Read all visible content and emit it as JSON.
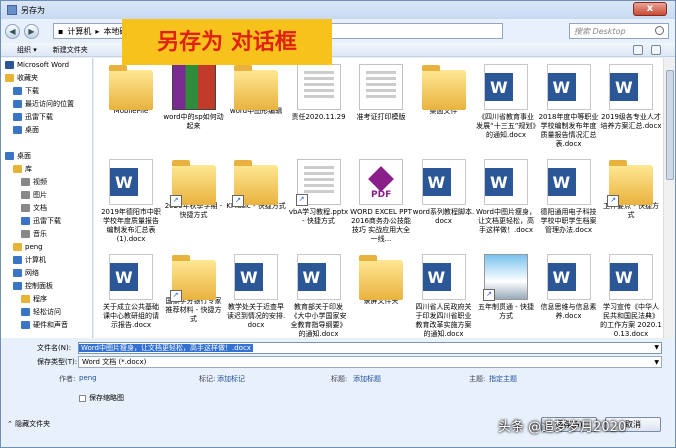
{
  "window": {
    "title": "另存为",
    "close": "x"
  },
  "banner": "另存为 对话框",
  "nav": {
    "back": "◀",
    "forward": "▶",
    "path": [
      "计算机",
      "本地磁"
    ],
    "search_placeholder": "搜索 Desktop"
  },
  "toolbar": {
    "organize": "组织 ▾",
    "new_folder": "新建文件夹"
  },
  "sidebar": [
    {
      "label": "Microsoft Word",
      "icon": "word-icon",
      "color": "#2b5797"
    },
    {
      "label": "收藏夹",
      "icon": "star-icon",
      "color": "#e7b437"
    },
    {
      "label": "下载",
      "icon": "folder-icon",
      "color": "#3a74c4"
    },
    {
      "label": "最近访问的位置",
      "icon": "folder-icon",
      "color": "#3a74c4"
    },
    {
      "label": "迅雷下载",
      "icon": "folder-icon",
      "color": "#3a74c4"
    },
    {
      "label": "桌面",
      "icon": "folder-icon",
      "color": "#3a74c4"
    },
    {
      "label": "",
      "icon": "",
      "color": ""
    },
    {
      "label": "桌面",
      "icon": "desktop-icon",
      "color": "#3a74c4"
    },
    {
      "label": "库",
      "icon": "library-icon",
      "color": "#e7b437"
    },
    {
      "label": "视频",
      "icon": "video-icon",
      "color": "#888"
    },
    {
      "label": "图片",
      "icon": "picture-icon",
      "color": "#888"
    },
    {
      "label": "文档",
      "icon": "document-icon",
      "color": "#888"
    },
    {
      "label": "迅雷下载",
      "icon": "folder-icon",
      "color": "#3a74c4"
    },
    {
      "label": "音乐",
      "icon": "music-icon",
      "color": "#888"
    },
    {
      "label": "peng",
      "icon": "user-icon",
      "color": "#e7b437"
    },
    {
      "label": "计算机",
      "icon": "computer-icon",
      "color": "#3a74c4"
    },
    {
      "label": "网络",
      "icon": "network-icon",
      "color": "#3a74c4"
    },
    {
      "label": "控制面板",
      "icon": "control-panel-icon",
      "color": "#3a74c4"
    },
    {
      "label": "程序",
      "icon": "folder-icon",
      "color": "#e7b437"
    },
    {
      "label": "轻松访问",
      "icon": "folder-icon",
      "color": "#3a74c4"
    },
    {
      "label": "硬件和声音",
      "icon": "folder-icon",
      "color": "#3a74c4"
    }
  ],
  "files": [
    {
      "name": "MobileFile",
      "type": "folder"
    },
    {
      "name": "word中的sp如何动起来",
      "type": "rar"
    },
    {
      "name": "word中图形编辑",
      "type": "folder"
    },
    {
      "name": "责任2020.11.29",
      "type": "generic"
    },
    {
      "name": "准考证打印模版",
      "type": "generic"
    },
    {
      "name": "桌面文件",
      "type": "folder"
    },
    {
      "name": "《四川省教育事业发展“十三五”规划》的通知.docx",
      "type": "word"
    },
    {
      "name": "2018年度中等职业学校编制发布年度质量报告情况汇总表.docx",
      "type": "word"
    },
    {
      "name": "2019级各专业人才培养方案汇总.docx",
      "type": "word"
    },
    {
      "name": "2019年德阳市中职学校年度质量报告编制发布汇总表 (1).docx",
      "type": "word"
    },
    {
      "name": "2020年秋季学期 - 快捷方式",
      "type": "folder-shortcut"
    },
    {
      "name": "KMusic - 快捷方式",
      "type": "folder-shortcut"
    },
    {
      "name": "vbA学习教程.pptx - 快捷方式",
      "type": "generic-shortcut"
    },
    {
      "name": "WORD EXCEL PPT2016商务办公技能 技巧 实战应用大全 一线...",
      "type": "pdf"
    },
    {
      "name": "word系列教程脚本.docx",
      "type": "word"
    },
    {
      "name": "Word中图片瘦身，让文档更轻松，高手这样做！.docx",
      "type": "word"
    },
    {
      "name": "德阳通用电子科技学校中职学生档案管理办法.docx",
      "type": "word"
    },
    {
      "name": "工作要点 - 快捷方式",
      "type": "folder-shortcut"
    },
    {
      "name": "关于成立公共基础课中心教研组的请示报告.docx",
      "type": "word"
    },
    {
      "name": "国家学分银行专家推荐材料 - 快捷方式",
      "type": "folder-shortcut"
    },
    {
      "name": "教学处关于近查早读迟到情况的安排.docx",
      "type": "word"
    },
    {
      "name": "教育部关于印发《大中小学国家安全教育指导纲要》的通知.docx",
      "type": "word"
    },
    {
      "name": "录屏文件夹",
      "type": "folder"
    },
    {
      "name": "四川省人民政府关于印发四川省职业教育改革实施方案的通知.docx",
      "type": "word"
    },
    {
      "name": "五年制贯通 - 快捷方式",
      "type": "image-shortcut"
    },
    {
      "name": "信息思维与信息素养.docx",
      "type": "word"
    },
    {
      "name": "学习宣传《中华人民共和国民法典》的工作方案 2020.10.13.docx",
      "type": "word"
    }
  ],
  "bottom": {
    "filename_label": "文件名(N):",
    "filename_value": "Word中图片瘦身，让文档更轻松，高手这样做！.docx",
    "filetype_label": "保存类型(T):",
    "filetype_value": "Word 文档 (*.docx)",
    "author_label": "作者:",
    "author_value": "peng",
    "tags_label": "标记:",
    "tags_value": "添加标记",
    "title_label": "标题:",
    "title_value": "添加标题",
    "subject_label": "主题:",
    "subject_value": "指定主题",
    "thumb_label": "保存缩略图",
    "hide_folders": "隐藏文件夹",
    "save": "保存(S)",
    "cancel": "取消"
  },
  "watermark": "头条 @追梦岁月2020"
}
